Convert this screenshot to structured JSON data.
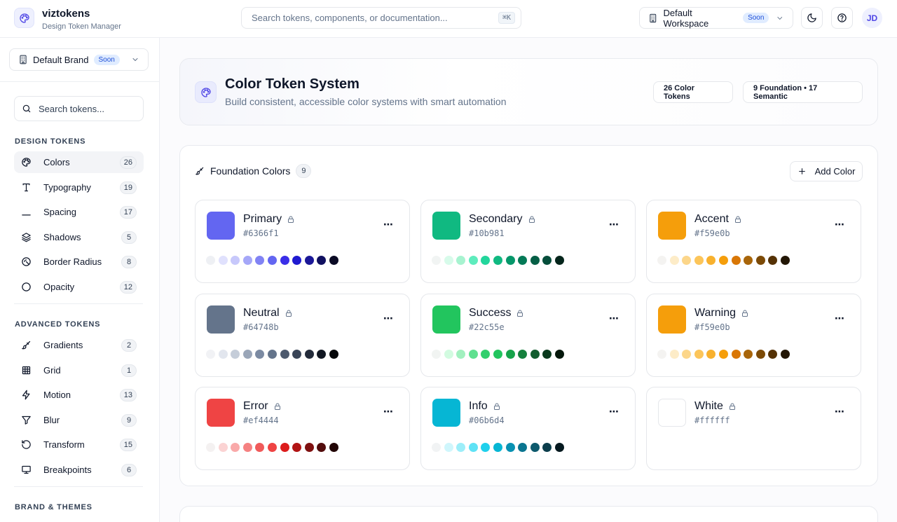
{
  "app": {
    "name": "viztokens",
    "subtitle": "Design Token Manager",
    "logo_icon": "palette-icon"
  },
  "header": {
    "search_placeholder": "Search tokens, components, or documentation...",
    "shortcut": "⌘K",
    "workspace": "Default Workspace",
    "workspace_badge": "Soon",
    "avatar_initials": "JD"
  },
  "sidebar": {
    "brand": "Default Brand",
    "brand_badge": "Soon",
    "search_placeholder": "Search tokens...",
    "design_tokens_label": "DESIGN TOKENS",
    "design_tokens": [
      {
        "label": "Colors",
        "count": "26",
        "icon": "palette-icon"
      },
      {
        "label": "Typography",
        "count": "19",
        "icon": "type-icon"
      },
      {
        "label": "Spacing",
        "count": "17",
        "icon": "spacing-icon"
      },
      {
        "label": "Shadows",
        "count": "5",
        "icon": "layers-icon"
      },
      {
        "label": "Border Radius",
        "count": "8",
        "icon": "radius-icon"
      },
      {
        "label": "Opacity",
        "count": "12",
        "icon": "circle-icon"
      }
    ],
    "advanced_tokens_label": "ADVANCED TOKENS",
    "advanced_tokens": [
      {
        "label": "Gradients",
        "count": "2",
        "icon": "brush-icon"
      },
      {
        "label": "Grid",
        "count": "1",
        "icon": "grid-icon"
      },
      {
        "label": "Motion",
        "count": "13",
        "icon": "zap-icon"
      },
      {
        "label": "Blur",
        "count": "9",
        "icon": "filter-icon"
      },
      {
        "label": "Transform",
        "count": "15",
        "icon": "rotate-icon"
      },
      {
        "label": "Breakpoints",
        "count": "6",
        "icon": "monitor-icon"
      }
    ],
    "brand_themes_label": "BRAND & THEMES"
  },
  "hero": {
    "title": "Color Token System",
    "subtitle": "Build consistent, accessible color systems with smart automation",
    "stat_tokens": "26 Color Tokens",
    "stat_breakdown": "9 Foundation • 17 Semantic"
  },
  "foundation": {
    "title": "Foundation Colors",
    "count": "9",
    "add_label": "Add Color",
    "colors": [
      {
        "name": "Primary",
        "hex": "#6366f1",
        "shades": [
          "#eef0f4",
          "#e0e1fd",
          "#c7c8fb",
          "#a5a7f8",
          "#8183f4",
          "#6366f1",
          "#3a2ee8",
          "#1f1ad0",
          "#1b1898",
          "#101060",
          "#0a0a24"
        ]
      },
      {
        "name": "Secondary",
        "hex": "#10b981",
        "shades": [
          "#f1f4f3",
          "#d7fbea",
          "#a7f3d0",
          "#5eecbd",
          "#22d69c",
          "#10b981",
          "#05976a",
          "#047a57",
          "#065f46",
          "#064e3b",
          "#04251b"
        ]
      },
      {
        "name": "Accent",
        "hex": "#f59e0b",
        "shades": [
          "#f4f3f1",
          "#fdecc8",
          "#fcd68a",
          "#fcc55a",
          "#f8b12e",
          "#f59e0b",
          "#d97706",
          "#a8650a",
          "#7c4a06",
          "#553205",
          "#231605"
        ]
      },
      {
        "name": "Neutral",
        "hex": "#64748b",
        "shades": [
          "#f1f2f5",
          "#e2e6ee",
          "#c5cdd9",
          "#9aa6b8",
          "#7b8aa2",
          "#64748b",
          "#4d5a6e",
          "#3a4557",
          "#232b3a",
          "#111722",
          "#040609"
        ]
      },
      {
        "name": "Success",
        "hex": "#22c55e",
        "shades": [
          "#f1f4f2",
          "#d2fbe0",
          "#a2f0bf",
          "#5fe08f",
          "#32cf6d",
          "#22c55e",
          "#16a34a",
          "#15803d",
          "#125c2e",
          "#0a3a1d",
          "#04170b"
        ]
      },
      {
        "name": "Warning",
        "hex": "#f59e0b",
        "shades": [
          "#f4f3f1",
          "#fdecc8",
          "#fcd68a",
          "#fcc55a",
          "#f8b12e",
          "#f59e0b",
          "#d97706",
          "#a8650a",
          "#7c4a06",
          "#553205",
          "#231605"
        ]
      },
      {
        "name": "Error",
        "hex": "#ef4444",
        "shades": [
          "#f4f1f1",
          "#fbd3d3",
          "#f9a9a9",
          "#f58181",
          "#f05a5a",
          "#ef4444",
          "#dc1c1c",
          "#b11414",
          "#7f1010",
          "#520c0c",
          "#220505"
        ]
      },
      {
        "name": "Info",
        "hex": "#06b6d4",
        "shades": [
          "#f1f3f4",
          "#cff6fc",
          "#9deef9",
          "#5fe2f5",
          "#1fd0ec",
          "#06b6d4",
          "#0891b2",
          "#0b7590",
          "#0e5a6d",
          "#0c3e4c",
          "#05191f"
        ]
      },
      {
        "name": "White",
        "hex": "#ffffff",
        "shades": []
      }
    ]
  }
}
